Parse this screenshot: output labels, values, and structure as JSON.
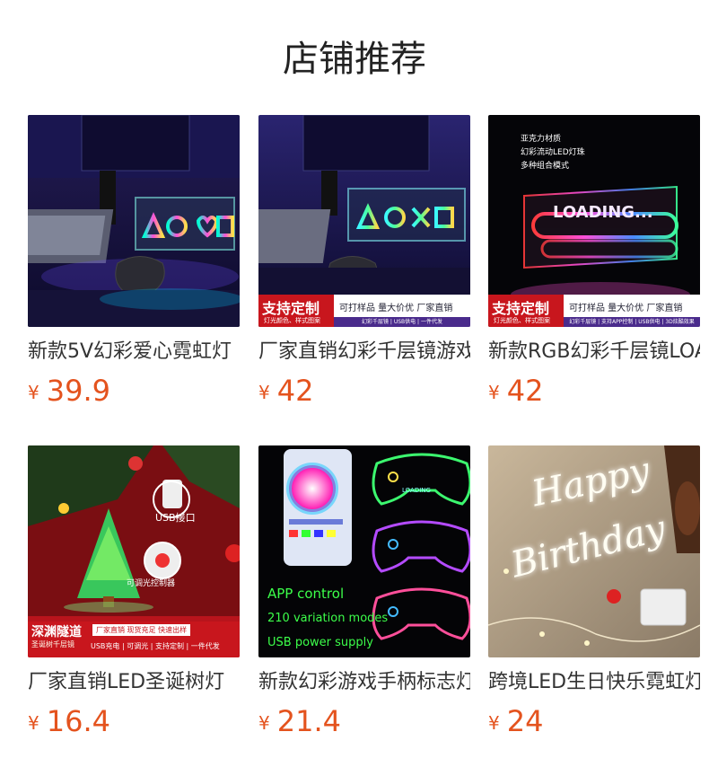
{
  "section": {
    "title": "店铺推荐"
  },
  "currency_symbol": "¥",
  "products": [
    {
      "name": "新款5V幻彩爱心霓虹灯",
      "price": "39.9",
      "image_text": {
        "symbols": "ΔOOO"
      }
    },
    {
      "name": "厂家直销幻彩千层镜游戏灯",
      "price": "42",
      "image_text": {
        "badge": "支持定制",
        "badge_sub": "灯光颜色、样式图案",
        "features": "可打样品  量大价优  厂家直销",
        "footer": "幻彩千层镜 | USB供电 | 一件代发"
      }
    },
    {
      "name": "新款RGB幻彩千层镜LOADING灯",
      "price": "42",
      "image_text": {
        "lines": [
          "亚克力材质",
          "幻彩流动LED灯珠",
          "多种组合模式"
        ],
        "sign": "LOADING...",
        "badge": "支持定制",
        "badge_sub": "灯光颜色、样式图案",
        "features": "可打样品  量大价优  厂家直销",
        "footer": "幻彩千层镜 | 支持APP控制 | USB供电 | 3D炫酷效果"
      }
    },
    {
      "name": "厂家直销LED圣诞树灯",
      "price": "16.4",
      "image_text": {
        "usb_label": "USB接口",
        "switch_label": "可调光控制器",
        "banner": "深渊隧道",
        "banner_sub": "圣诞树千层镜",
        "tag": "厂家直销 现货充足 快速出样",
        "features": "USB充电 | 可调光 | 支持定制 | 一件代发"
      }
    },
    {
      "name": "新款幻彩游戏手柄标志灯",
      "price": "21.4",
      "image_text": {
        "lines": [
          "APP control",
          "210 variation modes",
          "USB power supply"
        ],
        "sign": "LOADING"
      }
    },
    {
      "name": "跨境LED生日快乐霓虹灯",
      "price": "24",
      "image_text": {
        "line1": "Happy",
        "line2": "Birthday"
      }
    }
  ],
  "colors": {
    "price": "#e4531e",
    "title": "#222222",
    "badge_red": "#c8161d"
  }
}
